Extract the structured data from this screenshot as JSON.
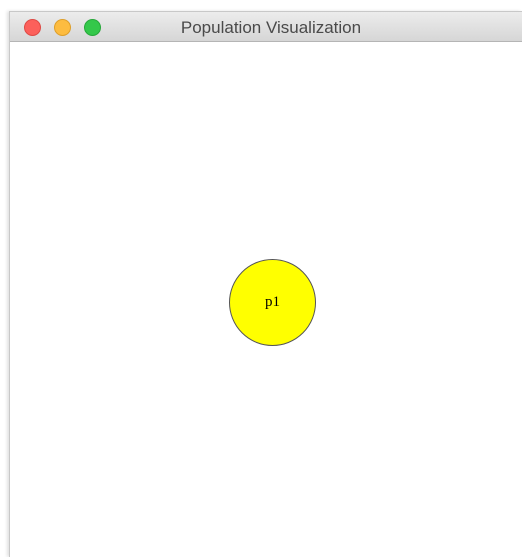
{
  "window": {
    "title": "Population Visualization"
  },
  "controls": {
    "close_icon": "close-icon",
    "minimize_icon": "minimize-icon",
    "maximize_icon": "maximize-icon"
  },
  "canvas": {
    "background": "#ffffff",
    "nodes": [
      {
        "label": "p1",
        "fill": "#ffff00",
        "stroke": "#555555"
      }
    ]
  }
}
